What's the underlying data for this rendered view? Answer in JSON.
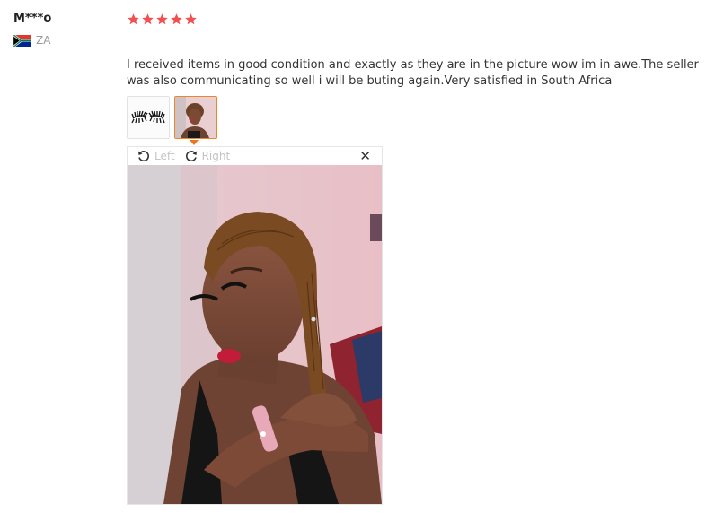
{
  "review": {
    "user_name": "M***o",
    "country_code": "ZA",
    "rating": 5,
    "rating_color": "#f0504f",
    "text": "I received items in good condition and exactly as they are in the picture wow im in awe.The seller was also communicating so well i will be buting again.Very satisfied in South Africa",
    "thumbnails": [
      {
        "icon": "eyelashes-photo",
        "active": false
      },
      {
        "icon": "selfie-photo",
        "active": true
      }
    ],
    "active_color": "#e8872b"
  },
  "viewer": {
    "rotate_left_label": "Left",
    "rotate_right_label": "Right",
    "close_symbol": "✕"
  }
}
